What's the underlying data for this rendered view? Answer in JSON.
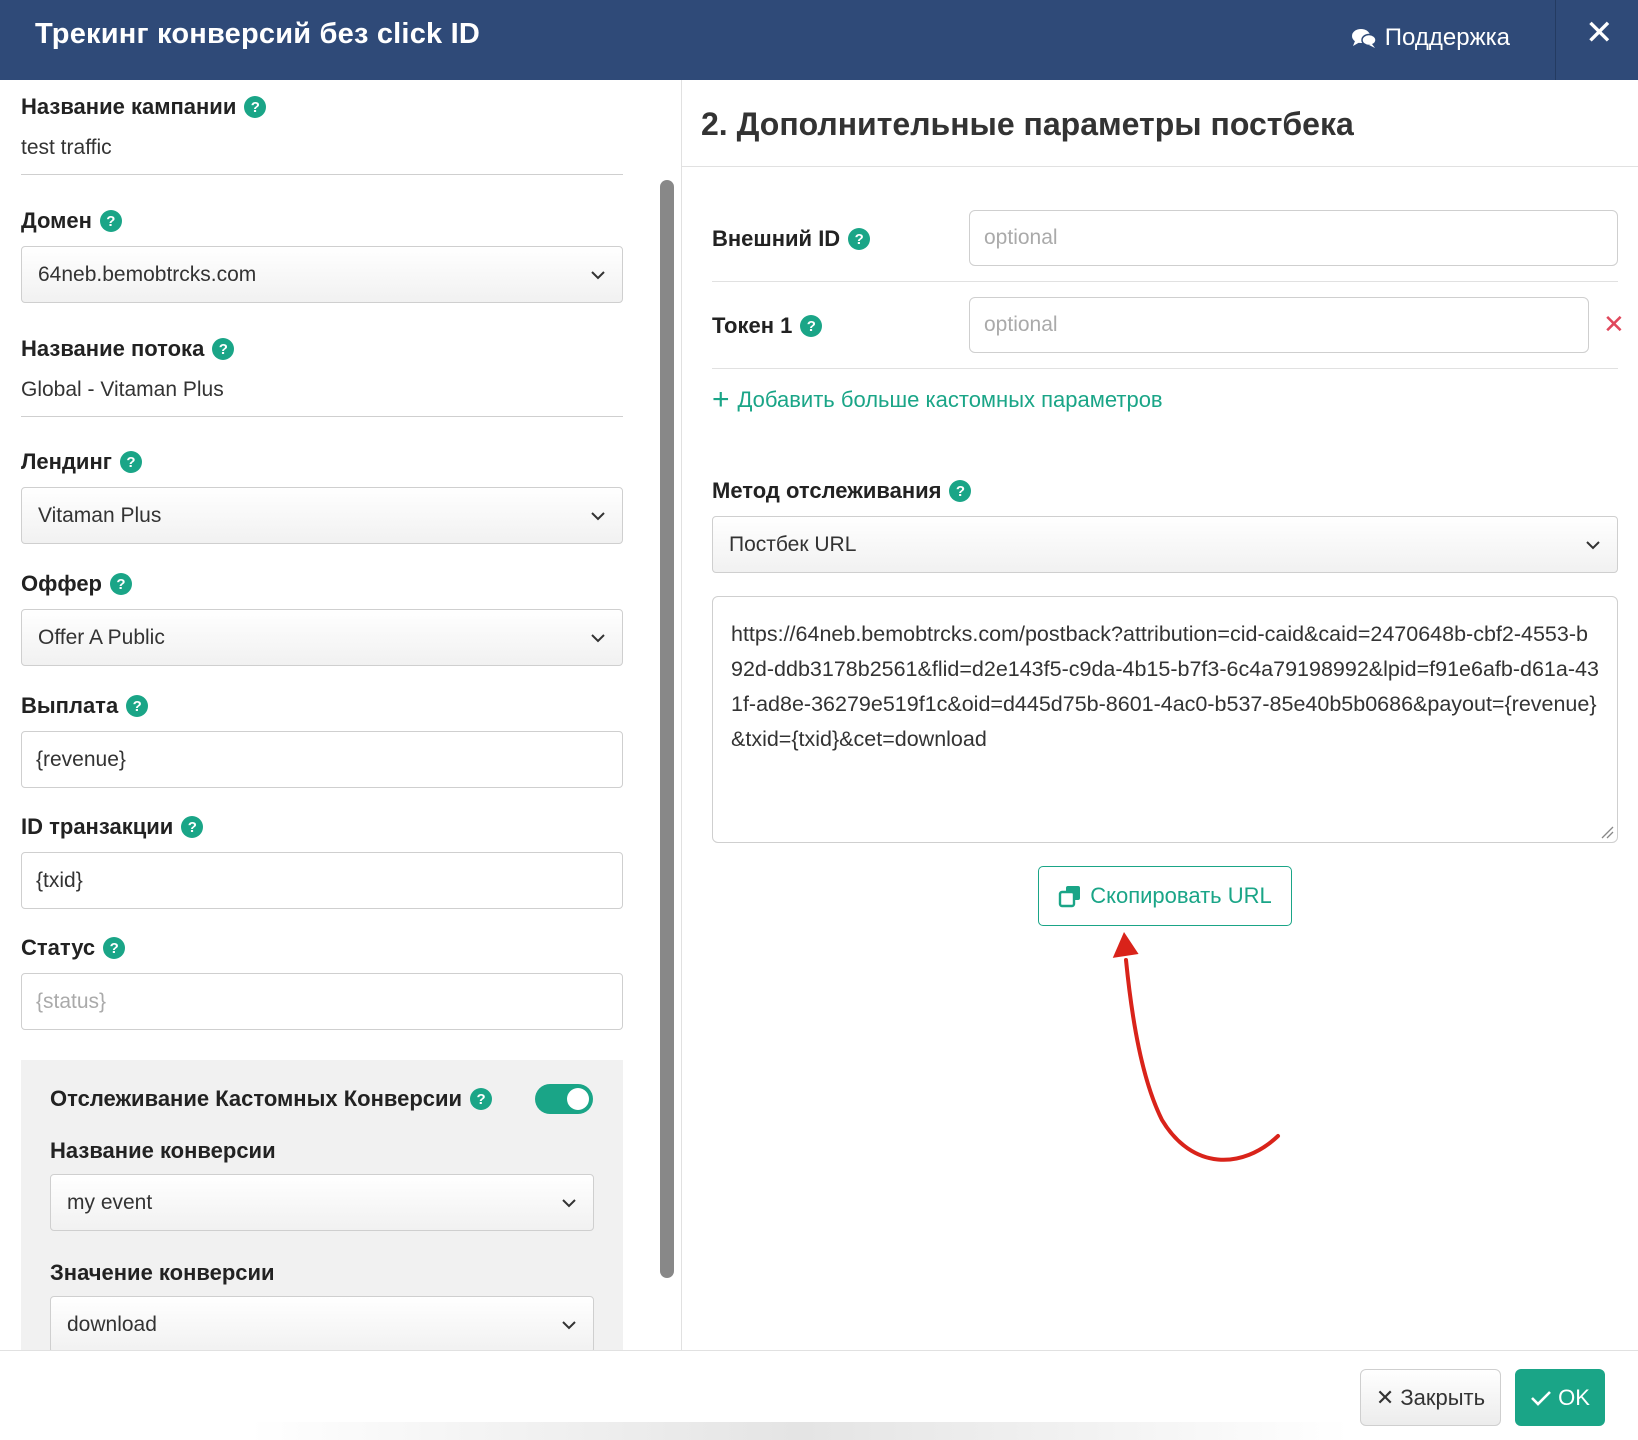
{
  "header": {
    "title": "Трекинг конверсий без click ID",
    "support_label": "Поддержка",
    "close_glyph": "✕"
  },
  "left": {
    "campaign": {
      "label": "Название кампании",
      "value": "test traffic"
    },
    "domain": {
      "label": "Домен",
      "value": "64neb.bemobtrcks.com"
    },
    "flow": {
      "label": "Название потока",
      "value": "Global - Vitaman Plus"
    },
    "landing": {
      "label": "Лендинг",
      "value": "Vitaman Plus"
    },
    "offer": {
      "label": "Оффер",
      "value": "Offer A Public"
    },
    "payout": {
      "label": "Выплата",
      "value": "{revenue}"
    },
    "txid": {
      "label": "ID транзакции",
      "value": "{txid}"
    },
    "status": {
      "label": "Статус",
      "placeholder": "{status}"
    },
    "custom_tracking": {
      "label": "Отслеживание Кастомных Конверсии",
      "enabled": true,
      "name_label": "Название конверсии",
      "name_value": "my event",
      "value_label": "Значение конверсии",
      "value_value": "download"
    }
  },
  "right": {
    "section_title": "2. Дополнительные параметры постбека",
    "external_id": {
      "label": "Внешний ID",
      "placeholder": "optional"
    },
    "token1": {
      "label": "Токен 1",
      "placeholder": "optional"
    },
    "add_more_label": "Добавить больше кастомных параметров",
    "method": {
      "label": "Метод отслеживания",
      "value": "Постбек URL"
    },
    "postback_url": "https://64neb.bemobtrcks.com/postback?attribution=cid-caid&caid=2470648b-cbf2-4553-b92d-ddb3178b2561&flid=d2e143f5-c9da-4b15-b7f3-6c4a79198992&lpid=f91e6afb-d61a-431f-ad8e-36279e519f1c&oid=d445d75b-8601-4ac0-b537-85e40b5b0686&payout={revenue}&txid={txid}&cet=download",
    "copy_label": "Скопировать URL"
  },
  "footer": {
    "close_label": "Закрыть",
    "ok_label": "OK"
  },
  "colors": {
    "header_bg": "#2f4a78",
    "accent": "#1aa587",
    "danger": "#e0485c",
    "annotation_arrow": "#d9231a"
  }
}
